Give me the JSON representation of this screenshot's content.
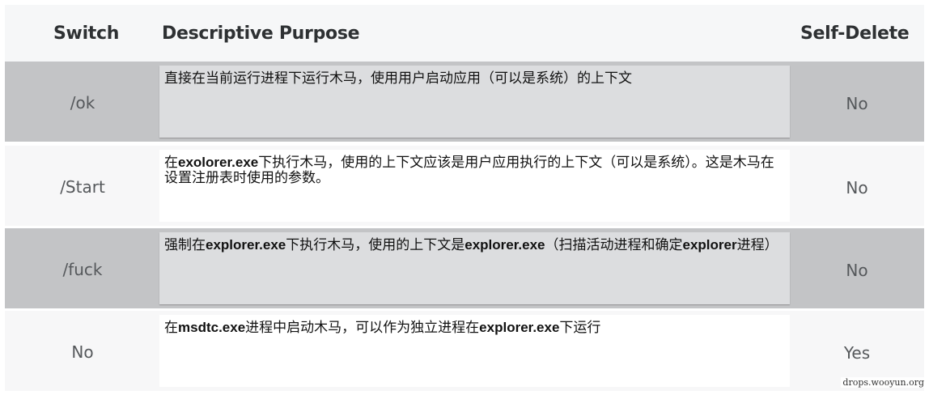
{
  "header": {
    "switch": "Switch",
    "purpose": "Descriptive Purpose",
    "self_delete": "Self-Delete"
  },
  "rows": [
    {
      "switch": "/ok",
      "purpose": [
        {
          "t": "直接在当前运行进程下运行木马，使用用户启动应用（可以是系统）的上下文",
          "b": false
        }
      ],
      "self_delete": "No"
    },
    {
      "switch": "/Start",
      "purpose": [
        {
          "t": "在",
          "b": false
        },
        {
          "t": "exolorer.exe",
          "b": true
        },
        {
          "t": "下执行木马，使用的上下文应该是用户应用执行的上下文（可以是系统）。这是木马在设置注册表时使用的参数。",
          "b": false
        }
      ],
      "self_delete": "No"
    },
    {
      "switch": "/fuck",
      "purpose": [
        {
          "t": "强制在",
          "b": false
        },
        {
          "t": "explorer.exe",
          "b": true
        },
        {
          "t": "下执行木马，使用的上下文是",
          "b": false
        },
        {
          "t": "explorer.exe",
          "b": true
        },
        {
          "t": "（扫描活动进程和确定",
          "b": false
        },
        {
          "t": "explorer",
          "b": true
        },
        {
          "t": "进程）",
          "b": false
        }
      ],
      "self_delete": "No"
    },
    {
      "switch": "No",
      "purpose": [
        {
          "t": "在",
          "b": false
        },
        {
          "t": "msdtc.exe",
          "b": true
        },
        {
          "t": "进程中启动木马，可以作为独立进程在",
          "b": false
        },
        {
          "t": "explorer.exe",
          "b": true
        },
        {
          "t": "下运行",
          "b": false
        }
      ],
      "self_delete": "Yes"
    }
  ],
  "watermark": "drops.wooyun.org"
}
